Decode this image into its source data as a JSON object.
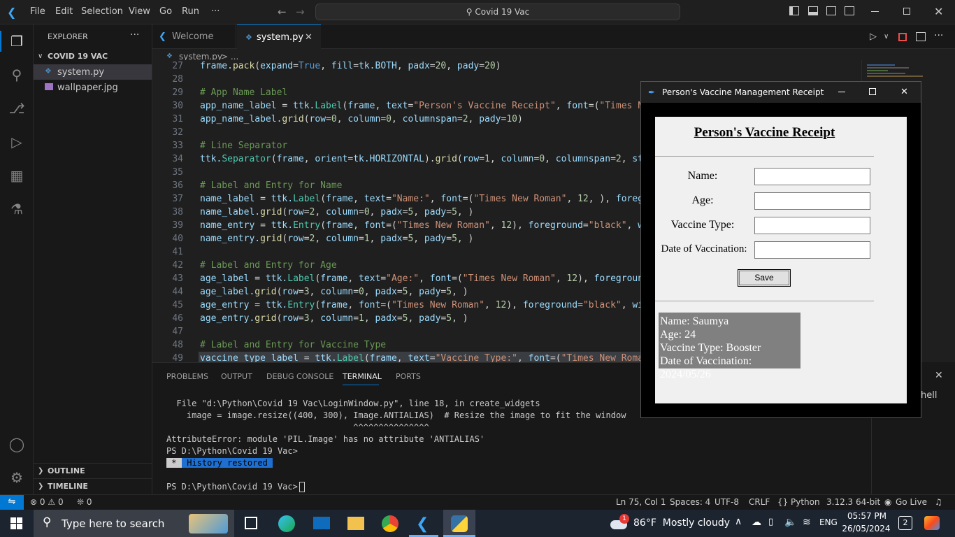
{
  "window": {
    "title": "Covid 19 Vac"
  },
  "menu": [
    "File",
    "Edit",
    "Selection",
    "View",
    "Go",
    "Run",
    "···"
  ],
  "explorer": {
    "header": "EXPLORER",
    "folder": "COVID 19 VAC",
    "files": [
      "system.py",
      "wallpaper.jpg"
    ],
    "outline": "OUTLINE",
    "timeline": "TIMELINE"
  },
  "tabs": [
    {
      "label": "Welcome"
    },
    {
      "label": "system.py"
    }
  ],
  "breadcrumb": {
    "file": "system.py",
    "rest": "> ..."
  },
  "code": {
    "line_numbers": [
      "27",
      "28",
      "29",
      "30",
      "31",
      "32",
      "33",
      "34",
      "35",
      "36",
      "37",
      "38",
      "39",
      "40",
      "41",
      "42",
      "43",
      "44",
      "45",
      "46",
      "47",
      "48",
      "49"
    ]
  },
  "panel": {
    "tabs": [
      "PROBLEMS",
      "OUTPUT",
      "DEBUG CONSOLE",
      "TERMINAL",
      "PORTS"
    ],
    "terminal_lines": [
      "  File \"d:\\Python\\Covid 19 Vac\\LoginWindow.py\", line 18, in create_widgets",
      "    image = image.resize((400, 300), Image.ANTIALIAS)  # Resize the image to fit the window",
      "                                     ^^^^^^^^^^^^^^^",
      "AttributeError: module 'PIL.Image' has no attribute 'ANTIALIAS'",
      "PS D:\\Python\\Covid 19 Vac>",
      "",
      "",
      "PS D:\\Python\\Covid 19 Vac> "
    ],
    "history_badge_star": " * ",
    "history_badge": " History restored ",
    "shell_label": "hell"
  },
  "status": {
    "errors": "0",
    "warnings": "0",
    "ports": "0",
    "position": "Ln 75, Col 1",
    "spaces": "Spaces: 4",
    "encoding": "UTF-8",
    "eol": "CRLF",
    "language": "Python",
    "version": "3.12.3 64-bit",
    "golive": "Go Live"
  },
  "tk": {
    "title": "Person's Vaccine Management Receipt",
    "heading": "Person's Vaccine Receipt",
    "labels": [
      "Name:",
      "Age:",
      "Vaccine Type:",
      "Date of Vaccination:"
    ],
    "save": "Save",
    "result": [
      "Name: Saumya",
      "Age: 24",
      "Vaccine Type: Booster",
      "Date of Vaccination: 2024/05/26"
    ]
  },
  "taskbar": {
    "search_placeholder": "Type here to search",
    "weather": "86°F  Mostly cloudy",
    "lang": "ENG",
    "time": "05:57 PM",
    "date": "26/05/2024",
    "notif_count": "2",
    "weather_badge": "1"
  },
  "colors": {
    "accent": "#0078d4",
    "comment": "#6a9955",
    "string": "#ce9178"
  }
}
